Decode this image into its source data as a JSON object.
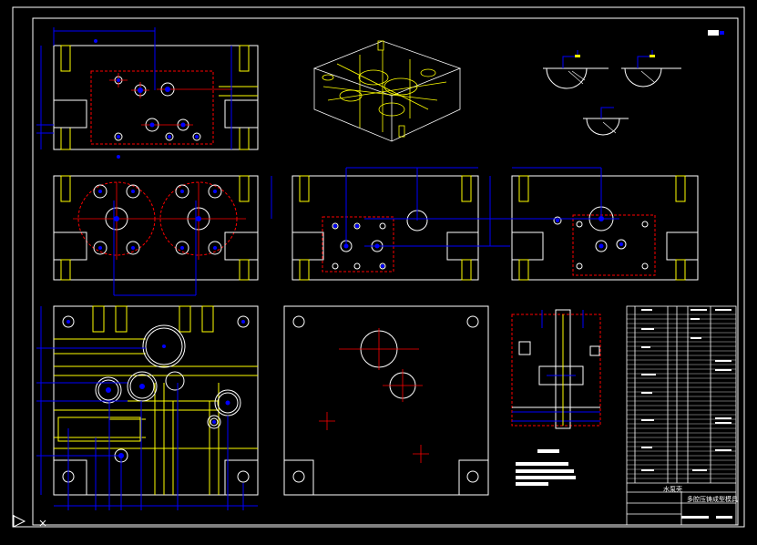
{
  "title_block": {
    "small_title": "水泵壳",
    "drawing_name": "多腔压铸成型模具"
  },
  "colors": {
    "background": "#000000",
    "outline": "#ffffff",
    "dimension": "#0000ff",
    "hidden": "#ffff00",
    "centerline": "#ff0000",
    "frame": "#ffffff"
  },
  "icons": [
    "ucs-axis-icon",
    "viewport-marker-icon"
  ]
}
